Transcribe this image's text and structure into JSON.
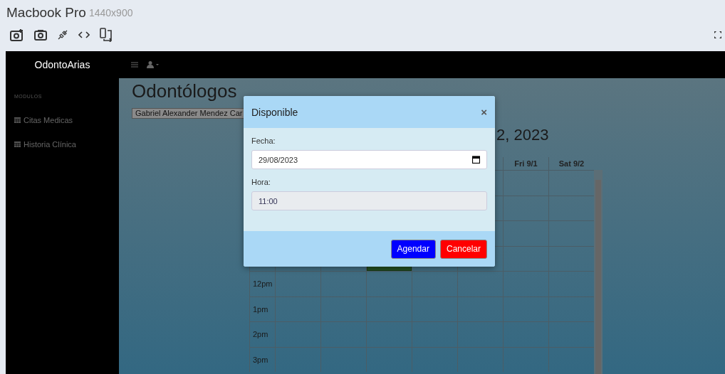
{
  "device_bar": {
    "device": "Macbook Pro",
    "resolution": "1440x900"
  },
  "sidebar": {
    "brand": "OdontoArias",
    "section": "MODULOS",
    "items": [
      {
        "label": "Citas Medicas"
      },
      {
        "label": "Historia Clínica"
      }
    ]
  },
  "page": {
    "title": "Odontólogos",
    "dentist_select": {
      "value": "Gabriel Alexander Mendez Car"
    }
  },
  "calendar": {
    "title": "2, 2023",
    "headers": [
      "Fri 9/1",
      "Sat 9/2"
    ],
    "rows": [
      {
        "cells": [
          {
            "kind": "empty"
          },
          {
            "kind": "empty"
          },
          {
            "kind": "empty"
          },
          {
            "kind": "empty"
          },
          {
            "kind": "empty"
          },
          {
            "kind": "empty"
          },
          {
            "kind": "empty"
          }
        ]
      },
      {
        "cells": [
          {
            "kind": "empty"
          },
          {
            "kind": "empty"
          },
          {
            "kind": "empty"
          },
          {
            "kind": "empty"
          },
          {
            "kind": "empty"
          },
          {
            "kind": "empty"
          },
          {
            "kind": "empty"
          }
        ]
      },
      {
        "cells": [
          {
            "kind": "empty"
          },
          {
            "kind": "empty"
          },
          {
            "kind": "empty"
          },
          {
            "kind": "empty"
          },
          {
            "kind": "empty"
          },
          {
            "kind": "empty"
          },
          {
            "kind": "empty"
          }
        ]
      },
      {
        "cells": [
          {
            "kind": "empty"
          },
          {
            "kind": "empty"
          },
          {
            "kind": "event"
          },
          {
            "kind": "empty"
          },
          {
            "kind": "empty"
          },
          {
            "kind": "empty"
          },
          {
            "kind": "empty"
          }
        ]
      },
      {
        "label": "12pm",
        "cells": [
          {
            "kind": "empty"
          },
          {
            "kind": "empty"
          },
          {
            "kind": "empty"
          },
          {
            "kind": "empty"
          },
          {
            "kind": "empty"
          },
          {
            "kind": "empty"
          },
          {
            "kind": "empty"
          }
        ]
      },
      {
        "label": "1pm",
        "cells": [
          {
            "kind": "empty"
          },
          {
            "kind": "empty"
          },
          {
            "kind": "empty"
          },
          {
            "kind": "empty"
          },
          {
            "kind": "empty"
          },
          {
            "kind": "empty"
          },
          {
            "kind": "empty"
          }
        ]
      },
      {
        "label": "2pm",
        "cells": [
          {
            "kind": "empty"
          },
          {
            "kind": "empty"
          },
          {
            "kind": "empty"
          },
          {
            "kind": "empty"
          },
          {
            "kind": "empty"
          },
          {
            "kind": "empty"
          },
          {
            "kind": "empty"
          }
        ]
      },
      {
        "label": "3pm",
        "cells": [
          {
            "kind": "empty"
          },
          {
            "kind": "empty"
          },
          {
            "kind": "empty"
          },
          {
            "kind": "empty"
          },
          {
            "kind": "empty"
          },
          {
            "kind": "empty"
          },
          {
            "kind": "empty"
          }
        ]
      }
    ]
  },
  "modal": {
    "title": "Disponible",
    "close": "×",
    "fields": [
      {
        "label": "Fecha:",
        "value": "29/08/2023",
        "kind": "date",
        "disabled": false
      },
      {
        "label": "Hora:",
        "value": "11:00",
        "kind": "time",
        "disabled": true
      }
    ],
    "buttons": [
      {
        "label": "Agendar",
        "kind": "primary"
      },
      {
        "label": "Cancelar",
        "kind": "danger"
      }
    ]
  }
}
